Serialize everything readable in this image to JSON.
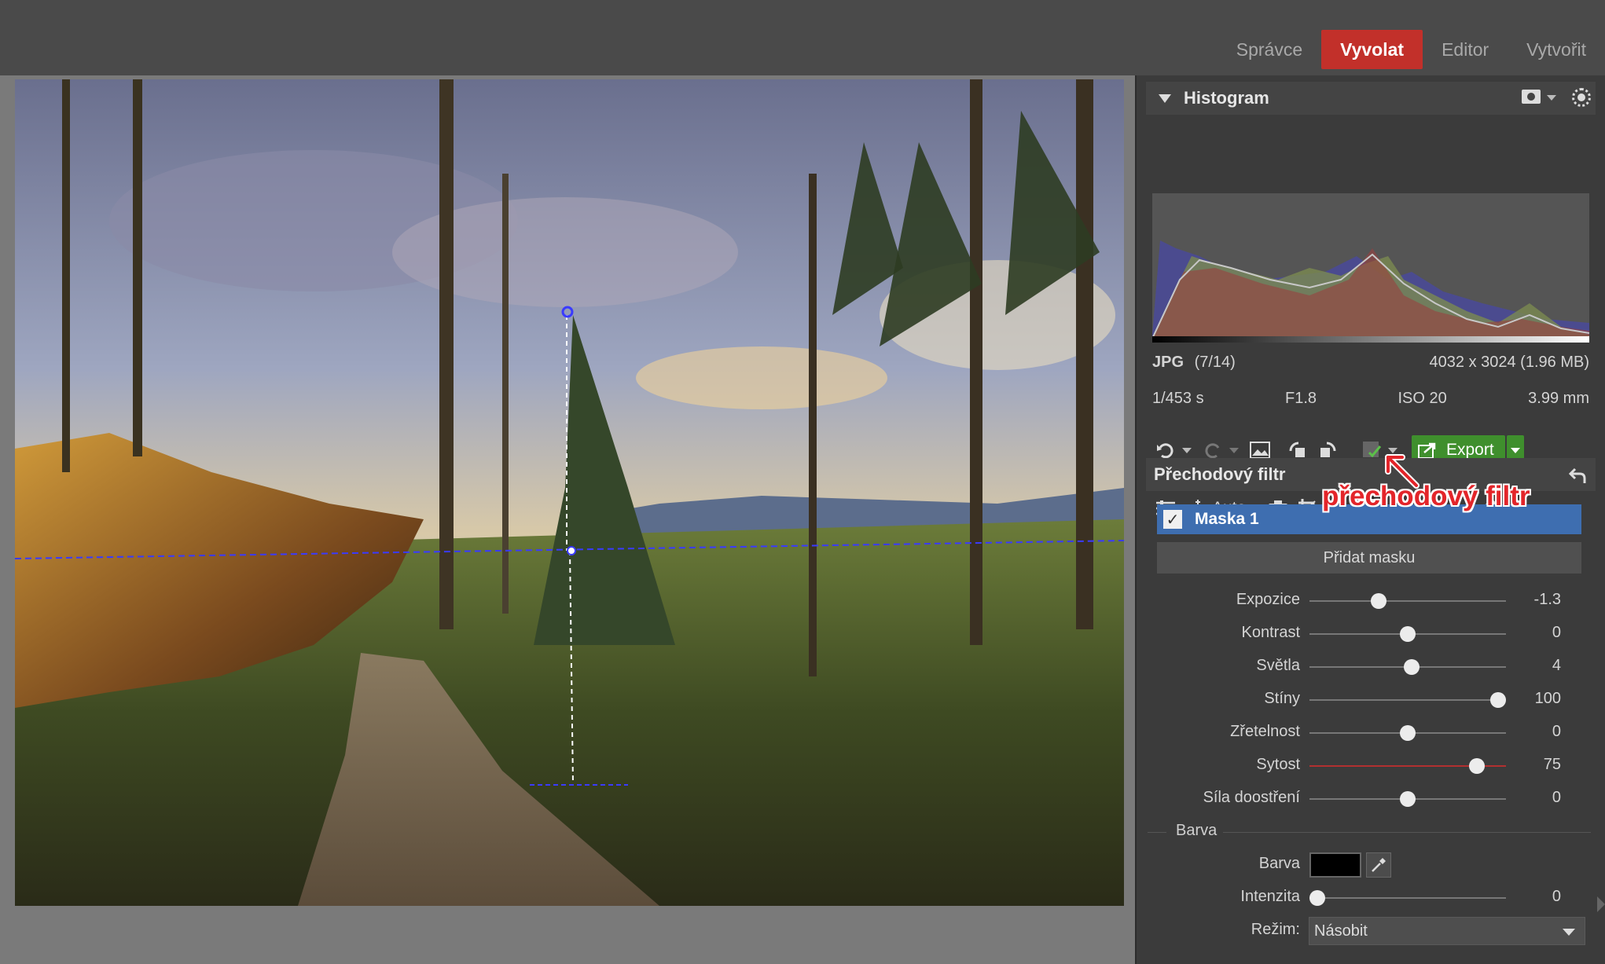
{
  "modes": {
    "tabs": [
      "Správce",
      "Vyvolat",
      "Editor",
      "Vytvořit"
    ],
    "active": "Vyvolat"
  },
  "histogram": {
    "title": "Histogram"
  },
  "file_info": {
    "format": "JPG",
    "index": "(7/14)",
    "dimensions": "4032 x 3024 (1.96 MB)",
    "shutter": "1/453 s",
    "aperture": "F1.8",
    "iso": "ISO 20",
    "focal": "3.99 mm"
  },
  "toolbar": {
    "export_label": "Export",
    "auto_label": "Auto"
  },
  "filter": {
    "title": "Přechodový filtr",
    "annotation": "přechodový filtr",
    "mask_label": "Maska 1",
    "mask_checked": true,
    "add_mask_label": "Přidat masku"
  },
  "sliders": [
    {
      "label": "Expozice",
      "value": "-1.3",
      "pos": 0.35,
      "color": "#777"
    },
    {
      "label": "Kontrast",
      "value": "0",
      "pos": 0.5,
      "color": "#777"
    },
    {
      "label": "Světla",
      "value": "4",
      "pos": 0.52,
      "color": "#777"
    },
    {
      "label": "Stíny",
      "value": "100",
      "pos": 0.96,
      "color": "#777"
    },
    {
      "label": "Zřetelnost",
      "value": "0",
      "pos": 0.5,
      "color": "#777"
    },
    {
      "label": "Sytost",
      "value": "75",
      "pos": 0.85,
      "color": "#b23030"
    },
    {
      "label": "Síla doostření",
      "value": "0",
      "pos": 0.5,
      "color": "#777"
    }
  ],
  "color_section": {
    "section_label": "Barva",
    "color_label": "Barva",
    "color_value": "#000000",
    "intensity_label": "Intenzita",
    "intensity_value": "0",
    "intensity_pos": 0.04,
    "mode_label": "Režim:",
    "mode_value": "Násobit"
  }
}
